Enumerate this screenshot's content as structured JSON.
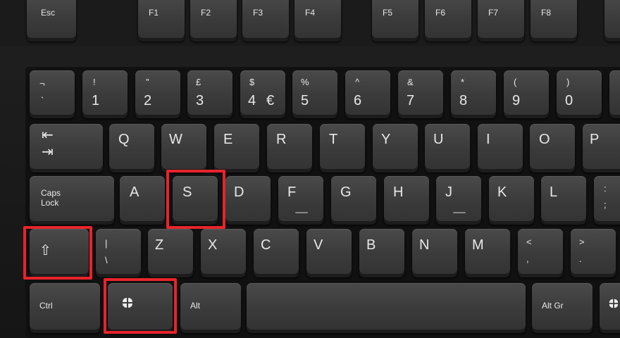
{
  "keys": {
    "esc": "Esc",
    "f1": "F1",
    "f2": "F2",
    "f3": "F3",
    "f4": "F4",
    "f5": "F5",
    "f6": "F6",
    "f7": "F7",
    "f8": "F8",
    "grave_top": "¬",
    "grave_bottom": "`",
    "n1_top": "!",
    "n1": "1",
    "n2_top": "\"",
    "n2": "2",
    "n3_top": "£",
    "n3": "3",
    "n4_top": "$",
    "n4": "4",
    "n4_alt": "€",
    "n5_top": "%",
    "n5": "5",
    "n6_top": "^",
    "n6": "6",
    "n7_top": "&",
    "n7": "7",
    "n8_top": "*",
    "n8": "8",
    "n9_top": "(",
    "n9": "9",
    "n0_top": ")",
    "n0": "0",
    "tab_top": "⇤",
    "tab_bottom": "⇥",
    "q": "Q",
    "w": "W",
    "e": "E",
    "r": "R",
    "t": "T",
    "y": "Y",
    "u": "U",
    "i": "I",
    "o": "O",
    "p": "P",
    "caps_line1": "Caps",
    "caps_line2": "Lock",
    "a": "A",
    "s": "S",
    "d": "D",
    "f": "F",
    "g": "G",
    "h": "H",
    "j": "J",
    "k": "K",
    "l": "L",
    "semicolon_top": ":",
    "semicolon_bottom": ";",
    "shift": "⇧",
    "backslash_top": "|",
    "backslash_bottom": "\\",
    "z": "Z",
    "x": "X",
    "c": "C",
    "v": "V",
    "b": "B",
    "n": "N",
    "m": "M",
    "comma_top": "<",
    "comma_bottom": ",",
    "period_top": ">",
    "period_bottom": ".",
    "ctrl": "Ctrl",
    "alt": "Alt",
    "altgr": "Alt Gr"
  },
  "colors": {
    "highlight": "#e8232b",
    "key_face": "#3e3e3e",
    "legend": "#e8e8e8"
  },
  "highlighted_keys": [
    "S",
    "Shift",
    "Windows"
  ]
}
